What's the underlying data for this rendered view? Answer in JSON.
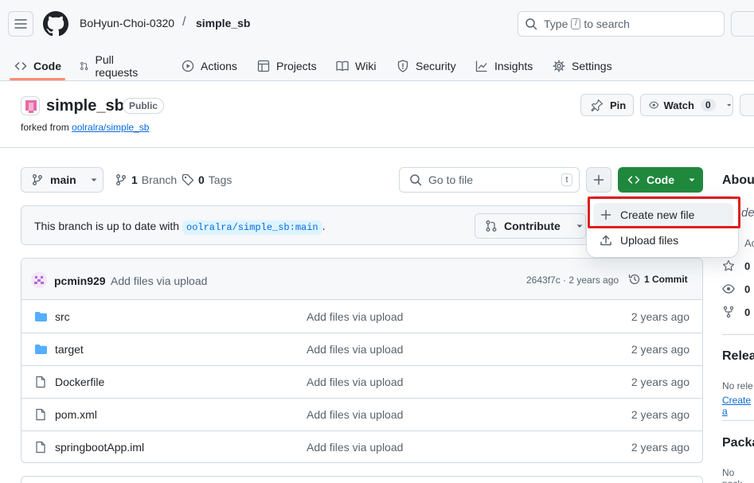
{
  "header": {
    "owner": "BoHyun-Choi-0320",
    "separator": "/",
    "repo": "simple_sb",
    "search_before": "Type",
    "search_key": "/",
    "search_after": "to search"
  },
  "tabs": [
    {
      "label": "Code",
      "icon": "code-icon"
    },
    {
      "label": "Pull requests",
      "icon": "pull-request-icon"
    },
    {
      "label": "Actions",
      "icon": "play-icon"
    },
    {
      "label": "Projects",
      "icon": "table-icon"
    },
    {
      "label": "Wiki",
      "icon": "book-icon"
    },
    {
      "label": "Security",
      "icon": "shield-icon"
    },
    {
      "label": "Insights",
      "icon": "graph-icon"
    },
    {
      "label": "Settings",
      "icon": "gear-icon"
    }
  ],
  "repo": {
    "name": "simple_sb",
    "visibility": "Public",
    "forked_prefix": "forked from",
    "forked_source": "oolralra/simple_sb",
    "pin_label": "Pin",
    "watch_label": "Watch",
    "watch_count": "0"
  },
  "toolbar": {
    "branch": "main",
    "branch_count": "1",
    "branch_word": "Branch",
    "tag_count": "0",
    "tag_word": "Tags",
    "goto_placeholder": "Go to file",
    "goto_key": "t",
    "code_label": "Code"
  },
  "status": {
    "text": "This branch is up to date with",
    "ref": "oolralra/simple_sb:main",
    "suffix": ".",
    "contribute_label": "Contribute"
  },
  "commit": {
    "author": "pcmin929",
    "message": "Add files via upload",
    "hash_age": "2643f7c · 2 years ago",
    "commits_label": "1 Commit"
  },
  "files": [
    {
      "name": "src",
      "type": "folder",
      "message": "Add files via upload",
      "age": "2 years ago"
    },
    {
      "name": "target",
      "type": "folder",
      "message": "Add files via upload",
      "age": "2 years ago"
    },
    {
      "name": "Dockerfile",
      "type": "file",
      "message": "Add files via upload",
      "age": "2 years ago"
    },
    {
      "name": "pom.xml",
      "type": "file",
      "message": "Add files via upload",
      "age": "2 years ago"
    },
    {
      "name": "springbootApp.iml",
      "type": "file",
      "message": "Add files via upload",
      "age": "2 years ago"
    }
  ],
  "dropdown": {
    "create": "Create new file",
    "upload": "Upload files"
  },
  "sidebar": {
    "about": "Abou",
    "desc_partial": "de",
    "activity_partial": "Ac",
    "stars": "0",
    "watchers": "0",
    "forks": "0",
    "releases": "Relea",
    "no_releases": "No rele",
    "create_release": "Create a",
    "packages": "Packa",
    "no_packages": "No pack"
  },
  "colors": {
    "accent_green": "#1f883d",
    "link_blue": "#0969da",
    "highlight_red": "#e01e1e",
    "tab_underline": "#fd8c73"
  }
}
